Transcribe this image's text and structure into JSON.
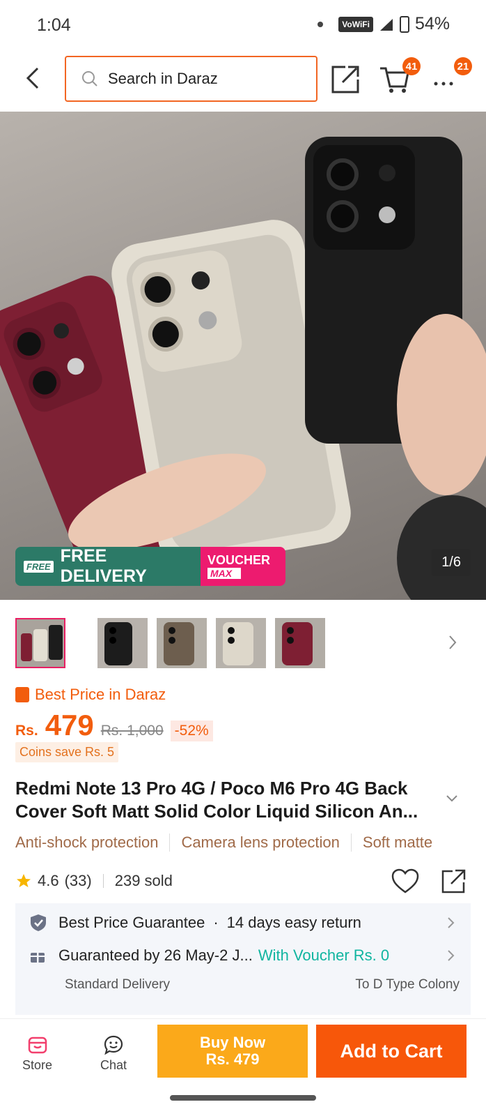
{
  "status_bar": {
    "time": "1:04",
    "network": "VoWiFi",
    "battery": "54%"
  },
  "header": {
    "search_placeholder": "Search in Daraz",
    "cart_badge": "41",
    "more_badge": "21"
  },
  "gallery": {
    "counter": "1/6",
    "promo_free_icon_text": "FREE",
    "promo_free_delivery": "FREE DELIVERY",
    "promo_voucher": "VOUCHER",
    "promo_max": "MAX",
    "case_colors": [
      "#7e1f33",
      "#d8d3c8",
      "#1c1c1c"
    ],
    "thumbnails": [
      {
        "name": "thumb-multi",
        "selected": true
      },
      {
        "name": "thumb-black",
        "selected": false
      },
      {
        "name": "thumb-brown",
        "selected": false
      },
      {
        "name": "thumb-cream",
        "selected": false
      },
      {
        "name": "thumb-maroon",
        "selected": false
      }
    ]
  },
  "product": {
    "best_price_label": "Best Price in Daraz",
    "currency": "Rs.",
    "price": "479",
    "old_price": "Rs. 1,000",
    "discount": "-52%",
    "coins": "Coins save Rs. 5",
    "title": "Redmi Note 13 Pro 4G / Poco M6 Pro 4G Back Cover Soft Matt Solid Color Liquid Silicon An...",
    "tags": [
      "Anti-shock protection",
      "Camera lens protection",
      "Soft matte"
    ],
    "rating": "4.6",
    "rating_count": "(33)",
    "sold": "239 sold"
  },
  "service": {
    "guarantee": "Best Price Guarantee",
    "returns": "14 days easy return",
    "delivery_guarantee": "Guaranteed by 26 May-2 J...",
    "voucher_text": "With Voucher Rs. 0",
    "delivery_type": "Standard Delivery",
    "destination": "To D Type Colony"
  },
  "bottom_bar": {
    "store": "Store",
    "chat": "Chat",
    "buy_now_line1": "Buy Now",
    "buy_now_line2": "Rs. 479",
    "add_to_cart": "Add to Cart"
  },
  "colors": {
    "accent": "#f25d0d",
    "buy_now": "#fba91a",
    "add_to_cart": "#f7570a",
    "free_delivery_bg": "#2c7a67",
    "voucher_bg": "#ed1b6f"
  }
}
